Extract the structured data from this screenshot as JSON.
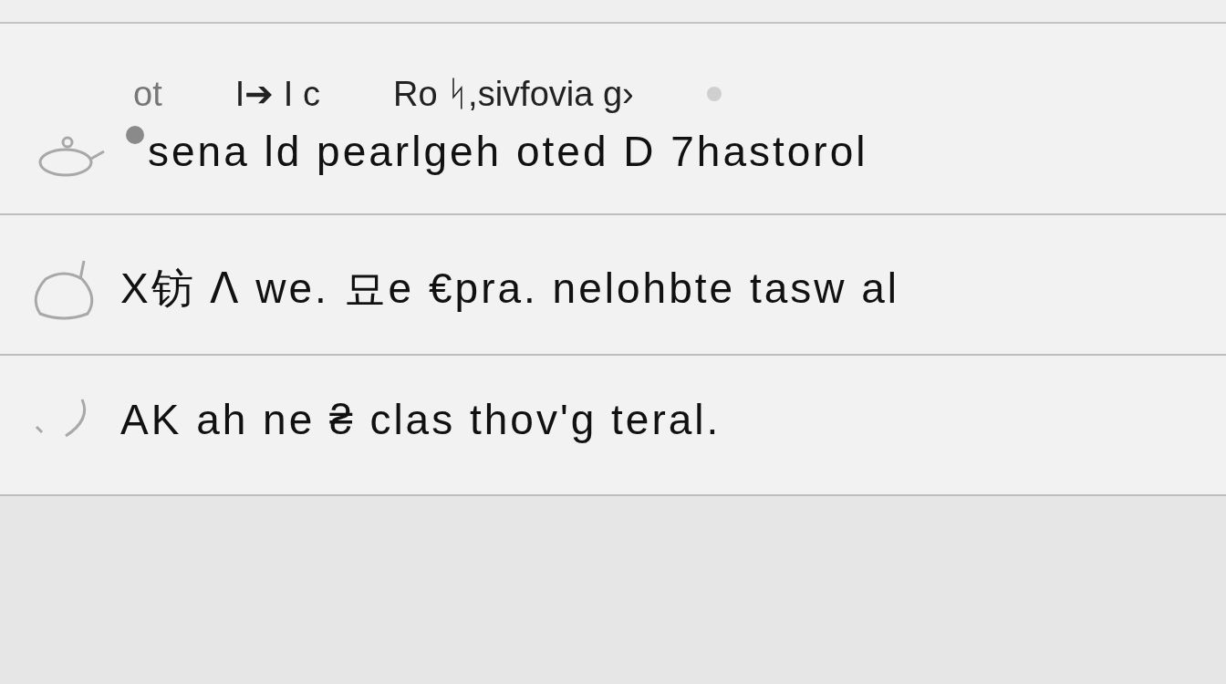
{
  "header": {
    "items": [
      "ot",
      "I➔ I c",
      "Ro ᛋ,sivfovia ɡ›"
    ]
  },
  "rows": [
    {
      "text": "sena ld  pearlgeh oted D 7hastorol",
      "dot": true
    },
    {
      "text": "X钫 ᐱ we. 묘e €pra. nelohbte tasw al",
      "dot": false
    },
    {
      "text": "AK ah ne ₴ clas thov'g teral.",
      "dot": false
    }
  ]
}
